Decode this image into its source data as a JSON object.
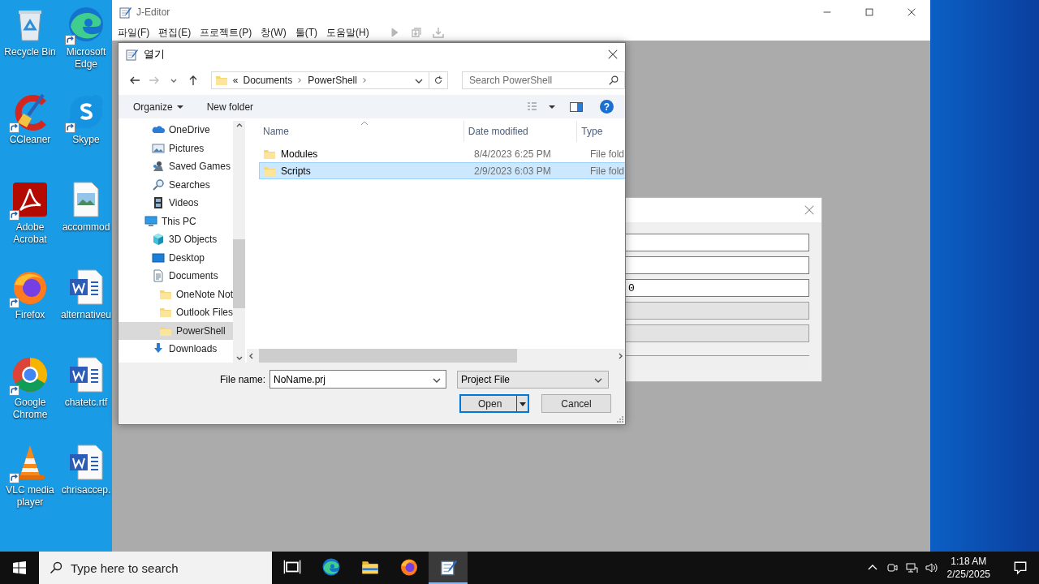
{
  "desktop": {
    "icons": [
      {
        "label": "Recycle Bin",
        "kind": "bin",
        "shortcut": false
      },
      {
        "label": "Microsoft Edge",
        "kind": "swirl",
        "shortcut": true
      },
      {
        "label": "CCleaner",
        "kind": "brush",
        "shortcut": true
      },
      {
        "label": "Skype",
        "kind": "chat",
        "shortcut": true
      },
      {
        "label": "Adobe Acrobat",
        "kind": "pdf",
        "shortcut": true
      },
      {
        "label": "accommod",
        "kind": "image",
        "shortcut": false
      },
      {
        "label": "Firefox",
        "kind": "fox",
        "shortcut": true
      },
      {
        "label": "alternativeu",
        "kind": "word",
        "shortcut": false
      },
      {
        "label": "Google Chrome",
        "kind": "ring",
        "shortcut": true
      },
      {
        "label": "chatetc.rtf",
        "kind": "word",
        "shortcut": false
      },
      {
        "label": "VLC media player",
        "kind": "cone",
        "shortcut": true
      },
      {
        "label": "chrisaccep.",
        "kind": "word",
        "shortcut": false
      }
    ]
  },
  "editor": {
    "title": "J-Editor",
    "menu": [
      "파일(F)",
      "편집(E)",
      "프로젝트(P)",
      "창(W)",
      "툴(T)",
      "도움말(H)"
    ],
    "toolbar": [
      {
        "kind": "run",
        "disabled": true
      },
      {
        "kind": "build",
        "disabled": true
      },
      {
        "kind": "deploy",
        "disabled": true
      }
    ]
  },
  "back_dialog": {
    "fields": [
      {
        "disabled": false
      },
      {
        "disabled": false
      },
      {
        "value": "0",
        "disabled": false
      },
      {
        "disabled": true
      },
      {
        "disabled": true
      }
    ]
  },
  "open_dialog": {
    "title": "열기",
    "address": {
      "overflow": "«",
      "crumbs": [
        "Documents",
        "PowerShell"
      ]
    },
    "search": {
      "placeholder": "Search PowerShell"
    },
    "commands": {
      "organize": "Organize",
      "new_folder": "New folder",
      "help": "?"
    },
    "tree": {
      "items": [
        {
          "children": [
            {
              "label": "OneDrive",
              "kind": "cloud",
              "selected": false
            },
            {
              "label": "Pictures",
              "kind": "pictures",
              "selected": false
            },
            {
              "label": "Saved Games",
              "kind": "games",
              "selected": false
            },
            {
              "label": "Searches",
              "kind": "search",
              "selected": false
            },
            {
              "label": "Videos",
              "kind": "videos",
              "selected": false
            }
          ]
        },
        {
          "label": "This PC",
          "kind": "pc",
          "selected": false,
          "children": [
            {
              "label": "3D Objects",
              "kind": "cube",
              "selected": false
            },
            {
              "label": "Desktop",
              "kind": "desktop",
              "selected": false
            },
            {
              "label": "Documents",
              "kind": "documents",
              "selected": false,
              "children": [
                {
                  "label": "OneNote Not",
                  "kind": "folder",
                  "selected": false
                },
                {
                  "label": "Outlook Files",
                  "kind": "folder",
                  "selected": false
                },
                {
                  "label": "PowerShell",
                  "kind": "folder",
                  "selected": true
                }
              ]
            },
            {
              "label": "Downloads",
              "kind": "downloads",
              "selected": false
            }
          ]
        }
      ]
    },
    "columns": [
      "Name",
      "Date modified",
      "Type"
    ],
    "rows": [
      {
        "name": "Modules",
        "date": "8/4/2023 6:25 PM",
        "type": "File fold",
        "selected": false
      },
      {
        "name": "Scripts",
        "date": "2/9/2023 6:03 PM",
        "type": "File fold",
        "selected": true
      }
    ],
    "file_name": {
      "label": "File name:",
      "value": "NoName.prj"
    },
    "file_type": "Project File",
    "buttons": [
      {
        "label": "Open",
        "default": true
      },
      {
        "label": "Cancel",
        "default": false
      }
    ]
  },
  "taskbar": {
    "search": {
      "placeholder": "Type here to search"
    },
    "apps": [
      {
        "kind": "taskview",
        "active": false
      },
      {
        "kind": "swirl",
        "active": false
      },
      {
        "kind": "explorer",
        "active": false
      },
      {
        "kind": "fox",
        "active": false
      },
      {
        "kind": "notepad",
        "active": true
      }
    ],
    "time": "1:18 AM",
    "date": "2/25/2025"
  }
}
